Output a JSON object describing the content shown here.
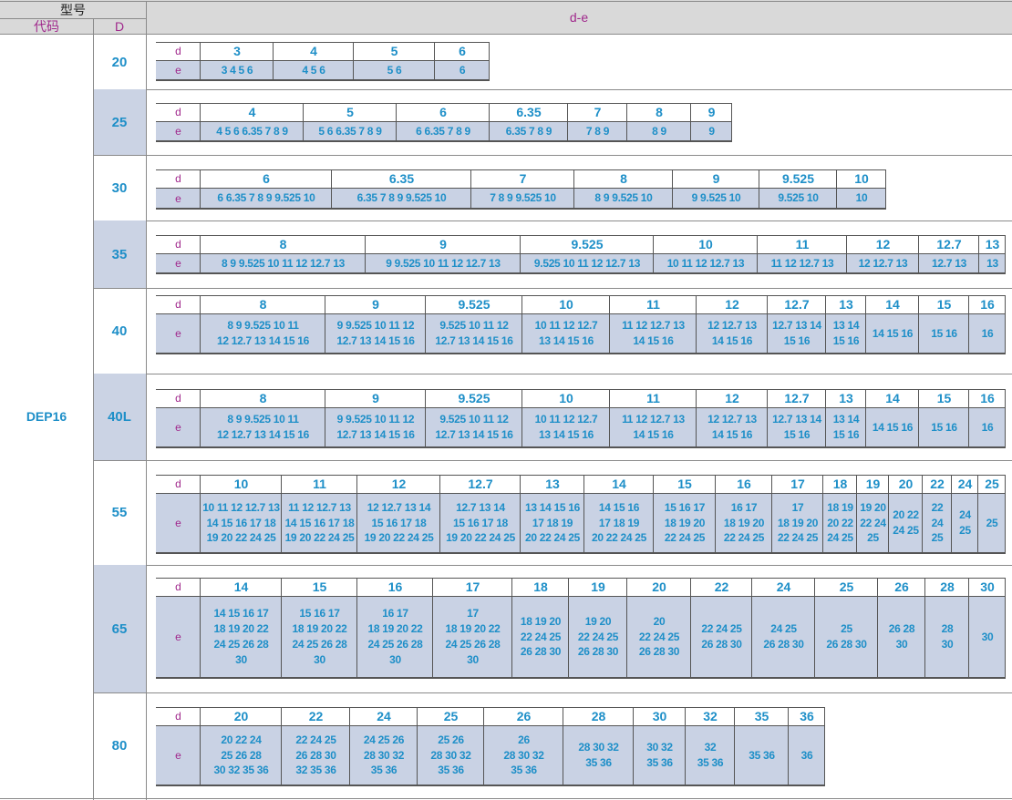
{
  "header": {
    "model": "型号",
    "code_label": "代码",
    "d_label": "D",
    "de_label": "d-e"
  },
  "code": "DEP16",
  "row_label": {
    "d": "d",
    "e": "e"
  },
  "rows": [
    {
      "D": "20",
      "cells": [
        {
          "d": "3",
          "e": "3 4 5 6"
        },
        {
          "d": "4",
          "e": "4 5 6"
        },
        {
          "d": "5",
          "e": "5 6"
        },
        {
          "d": "6",
          "e": "6"
        }
      ]
    },
    {
      "D": "25",
      "cells": [
        {
          "d": "4",
          "e": "4 5 6 6.35 7 8 9"
        },
        {
          "d": "5",
          "e": "5 6 6.35 7 8 9"
        },
        {
          "d": "6",
          "e": "6 6.35 7 8 9"
        },
        {
          "d": "6.35",
          "e": "6.35 7 8 9"
        },
        {
          "d": "7",
          "e": "7 8 9"
        },
        {
          "d": "8",
          "e": "8 9"
        },
        {
          "d": "9",
          "e": "9"
        }
      ]
    },
    {
      "D": "30",
      "cells": [
        {
          "d": "6",
          "e": "6 6.35 7 8 9 9.525 10"
        },
        {
          "d": "6.35",
          "e": "6.35 7 8 9 9.525 10"
        },
        {
          "d": "7",
          "e": "7 8 9 9.525 10"
        },
        {
          "d": "8",
          "e": "8 9 9.525 10"
        },
        {
          "d": "9",
          "e": "9 9.525 10"
        },
        {
          "d": "9.525",
          "e": "9.525 10"
        },
        {
          "d": "10",
          "e": "10"
        }
      ]
    },
    {
      "D": "35",
      "cells": [
        {
          "d": "8",
          "e": "8 9 9.525 10 11 12 12.7 13"
        },
        {
          "d": "9",
          "e": "9 9.525 10 11 12 12.7 13"
        },
        {
          "d": "9.525",
          "e": "9.525 10 11 12 12.7 13"
        },
        {
          "d": "10",
          "e": "10 11 12 12.7 13"
        },
        {
          "d": "11",
          "e": "11 12 12.7 13"
        },
        {
          "d": "12",
          "e": "12 12.7 13"
        },
        {
          "d": "12.7",
          "e": "12.7 13"
        },
        {
          "d": "13",
          "e": "13"
        }
      ]
    },
    {
      "D": "40",
      "cells": [
        {
          "d": "8",
          "e": "8 9 9.525 10 11\n12 12.7 13 14 15 16"
        },
        {
          "d": "9",
          "e": "9 9.525 10 11 12\n12.7 13 14 15 16"
        },
        {
          "d": "9.525",
          "e": "9.525 10 11 12\n12.7 13 14 15 16"
        },
        {
          "d": "10",
          "e": "10 11 12 12.7\n13 14 15 16"
        },
        {
          "d": "11",
          "e": "11 12 12.7 13\n14 15 16"
        },
        {
          "d": "12",
          "e": "12 12.7 13\n14 15 16"
        },
        {
          "d": "12.7",
          "e": "12.7 13 14\n15 16"
        },
        {
          "d": "13",
          "e": "13 14\n15 16"
        },
        {
          "d": "14",
          "e": "14 15 16"
        },
        {
          "d": "15",
          "e": "15 16"
        },
        {
          "d": "16",
          "e": "16"
        }
      ]
    },
    {
      "D": "40L",
      "cells": [
        {
          "d": "8",
          "e": "8 9 9.525 10 11\n12 12.7 13 14 15 16"
        },
        {
          "d": "9",
          "e": "9 9.525 10 11 12\n12.7 13 14 15 16"
        },
        {
          "d": "9.525",
          "e": "9.525 10 11 12\n12.7 13 14 15 16"
        },
        {
          "d": "10",
          "e": "10 11 12 12.7\n13 14 15 16"
        },
        {
          "d": "11",
          "e": "11 12 12.7 13\n14 15 16"
        },
        {
          "d": "12",
          "e": "12 12.7 13\n14 15 16"
        },
        {
          "d": "12.7",
          "e": "12.7 13 14\n15 16"
        },
        {
          "d": "13",
          "e": "13 14\n15 16"
        },
        {
          "d": "14",
          "e": "14 15 16"
        },
        {
          "d": "15",
          "e": "15 16"
        },
        {
          "d": "16",
          "e": "16"
        }
      ]
    },
    {
      "D": "55",
      "cells": [
        {
          "d": "10",
          "e": "10 11 12 12.7 13\n14 15 16 17 18\n19 20 22 24 25"
        },
        {
          "d": "11",
          "e": "11 12 12.7 13\n14 15 16 17 18\n19 20 22 24 25"
        },
        {
          "d": "12",
          "e": "12 12.7 13 14\n15 16 17 18\n19 20 22 24 25"
        },
        {
          "d": "12.7",
          "e": "12.7 13 14\n15 16 17 18\n19 20 22 24 25"
        },
        {
          "d": "13",
          "e": "13 14 15 16\n17 18 19\n20 22 24 25"
        },
        {
          "d": "14",
          "e": "14 15 16\n17 18 19\n20 22 24 25"
        },
        {
          "d": "15",
          "e": "15 16 17\n18 19 20\n22 24 25"
        },
        {
          "d": "16",
          "e": "16 17\n18 19 20\n22 24 25"
        },
        {
          "d": "17",
          "e": "17\n18 19 20\n22 24 25"
        },
        {
          "d": "18",
          "e": "18 19\n20 22\n24 25"
        },
        {
          "d": "19",
          "e": "19 20\n22 24\n25"
        },
        {
          "d": "20",
          "e": "20 22\n24 25"
        },
        {
          "d": "22",
          "e": "22\n24\n25"
        },
        {
          "d": "24",
          "e": "24\n25"
        },
        {
          "d": "25",
          "e": "25"
        }
      ]
    },
    {
      "D": "65",
      "cells": [
        {
          "d": "14",
          "e": "14 15 16 17\n18 19 20 22\n24 25 26 28\n30"
        },
        {
          "d": "15",
          "e": "15 16 17\n18 19 20 22\n24 25 26 28\n30"
        },
        {
          "d": "16",
          "e": "16 17\n18 19 20 22\n24 25 26 28\n30"
        },
        {
          "d": "17",
          "e": "17\n18 19 20 22\n24 25 26 28\n30"
        },
        {
          "d": "18",
          "e": "18 19 20\n22 24 25\n26 28 30"
        },
        {
          "d": "19",
          "e": "19 20\n22 24 25\n26 28 30"
        },
        {
          "d": "20",
          "e": "20\n22 24 25\n26 28 30"
        },
        {
          "d": "22",
          "e": "22 24 25\n26 28 30"
        },
        {
          "d": "24",
          "e": "24 25\n26 28 30"
        },
        {
          "d": "25",
          "e": "25\n26 28 30"
        },
        {
          "d": "26",
          "e": "26 28\n30"
        },
        {
          "d": "28",
          "e": "28\n30"
        },
        {
          "d": "30",
          "e": "30"
        }
      ]
    },
    {
      "D": "80",
      "cells": [
        {
          "d": "20",
          "e": "20 22 24\n25 26 28\n30 32 35 36"
        },
        {
          "d": "22",
          "e": "22 24 25\n26 28 30\n32 35 36"
        },
        {
          "d": "24",
          "e": "24 25 26\n28 30 32\n35 36"
        },
        {
          "d": "25",
          "e": "25 26\n28 30 32\n35 36"
        },
        {
          "d": "26",
          "e": "26\n28 30 32\n35 36"
        },
        {
          "d": "28",
          "e": "28 30 32\n35 36"
        },
        {
          "d": "30",
          "e": "30 32\n35 36"
        },
        {
          "d": "32",
          "e": "32\n35 36"
        },
        {
          "d": "35",
          "e": "35 36"
        },
        {
          "d": "36",
          "e": "36"
        }
      ]
    }
  ]
}
